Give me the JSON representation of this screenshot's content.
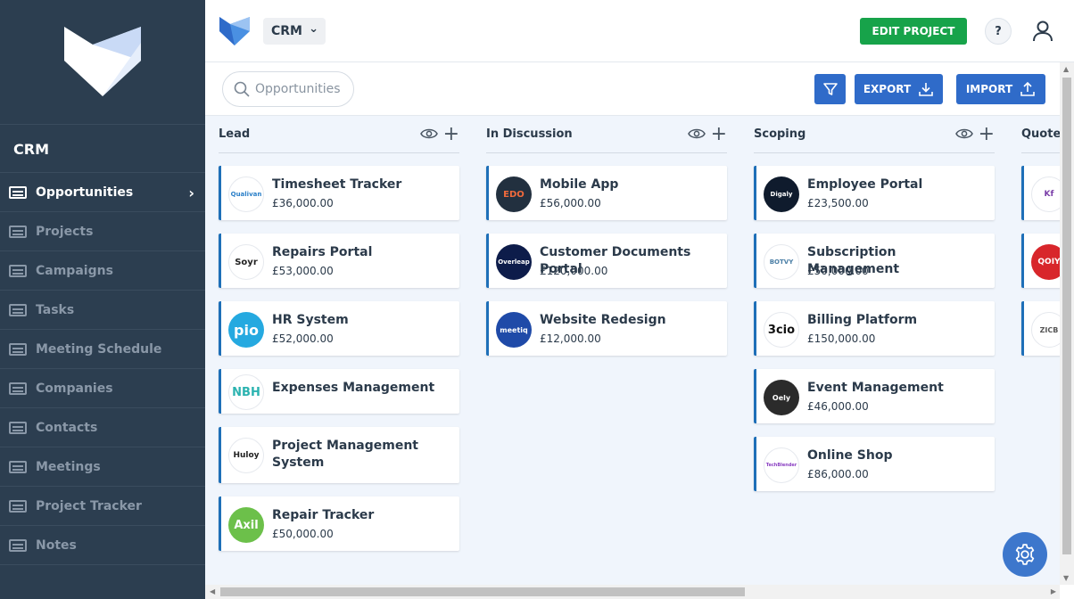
{
  "sidebar": {
    "title": "CRM",
    "items": [
      {
        "label": "Opportunities",
        "active": true
      },
      {
        "label": "Projects"
      },
      {
        "label": "Campaigns"
      },
      {
        "label": "Tasks"
      },
      {
        "label": "Meeting Schedule"
      },
      {
        "label": "Companies"
      },
      {
        "label": "Contacts"
      },
      {
        "label": "Meetings"
      },
      {
        "label": "Project Tracker"
      },
      {
        "label": "Notes"
      }
    ]
  },
  "header": {
    "app_select": "CRM",
    "edit_label": "EDIT PROJECT",
    "help_label": "?"
  },
  "toolbar": {
    "search_placeholder": "Opportunities",
    "export_label": "EXPORT",
    "import_label": "IMPORT"
  },
  "board": {
    "columns": [
      {
        "name": "Lead",
        "cards": [
          {
            "title": "Timesheet Tracker",
            "value": "£36,000.00",
            "logo": "Qualivan"
          },
          {
            "title": "Repairs Portal",
            "value": "£53,000.00",
            "logo": "Soyr"
          },
          {
            "title": "HR System",
            "value": "£52,000.00",
            "logo": "pio"
          },
          {
            "title": "Expenses Management",
            "value": "",
            "logo": "NBH"
          },
          {
            "title": "Project Management System",
            "value": "",
            "logo": "Huloy"
          },
          {
            "title": "Repair Tracker",
            "value": "£50,000.00",
            "logo": "Axil"
          }
        ]
      },
      {
        "name": "In Discussion",
        "cards": [
          {
            "title": "Mobile App",
            "value": "£56,000.00",
            "logo": "EDO"
          },
          {
            "title": "Customer Documents Portal",
            "value": "£120,000.00",
            "logo": "Overleap"
          },
          {
            "title": "Website Redesign",
            "value": "£12,000.00",
            "logo": "meetiq"
          }
        ]
      },
      {
        "name": "Scoping",
        "cards": [
          {
            "title": "Employee Portal",
            "value": "£23,500.00",
            "logo": "Digaly"
          },
          {
            "title": "Subscription Management",
            "value": "£50,000.00",
            "logo": "BOTVY"
          },
          {
            "title": "Billing Platform",
            "value": "£150,000.00",
            "logo": "3cio"
          },
          {
            "title": "Event Management",
            "value": "£46,000.00",
            "logo": "Oely"
          },
          {
            "title": "Online Shop",
            "value": "£86,000.00",
            "logo": "TechBlender"
          }
        ]
      },
      {
        "name": "Quote",
        "cards": [
          {
            "logo": "Kf"
          },
          {
            "logo": "QOIY"
          },
          {
            "logo": "ZICB"
          }
        ]
      }
    ]
  },
  "colors": {
    "sidebar": "#2c3e50",
    "accent": "#2f6bc9",
    "edit": "#17a34a",
    "card_border": "#1e6fb8"
  }
}
